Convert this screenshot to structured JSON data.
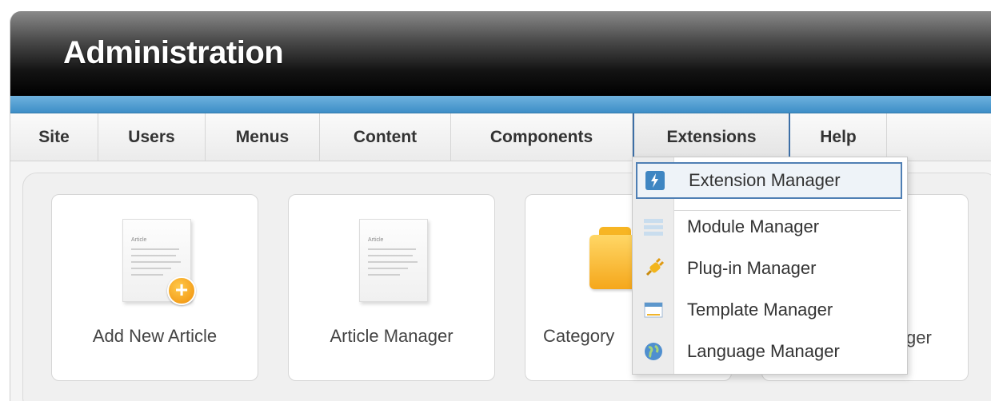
{
  "header": {
    "title": "Administration"
  },
  "menu": {
    "items": [
      {
        "label": "Site"
      },
      {
        "label": "Users"
      },
      {
        "label": "Menus"
      },
      {
        "label": "Content"
      },
      {
        "label": "Components"
      },
      {
        "label": "Extensions",
        "active": true
      },
      {
        "label": "Help"
      }
    ]
  },
  "cards": [
    {
      "label": "Add New Article",
      "icon": "add-article-icon",
      "doc_title": "Article"
    },
    {
      "label": "Article Manager",
      "icon": "article-icon",
      "doc_title": "Article"
    },
    {
      "label": "Category",
      "icon": "folder-icon"
    },
    {
      "label_partial": "ger"
    }
  ],
  "dropdown": {
    "items": [
      {
        "label": "Extension Manager",
        "icon": "lightning-icon",
        "highlighted": true
      },
      {
        "label": "Module Manager",
        "icon": "module-icon"
      },
      {
        "label": "Plug-in Manager",
        "icon": "plug-icon"
      },
      {
        "label": "Template Manager",
        "icon": "template-icon"
      },
      {
        "label": "Language Manager",
        "icon": "globe-icon"
      }
    ]
  },
  "colors": {
    "accent_blue": "#3d8ec7",
    "active_border": "#3d6fa6",
    "badge_orange": "#f08f0a"
  }
}
